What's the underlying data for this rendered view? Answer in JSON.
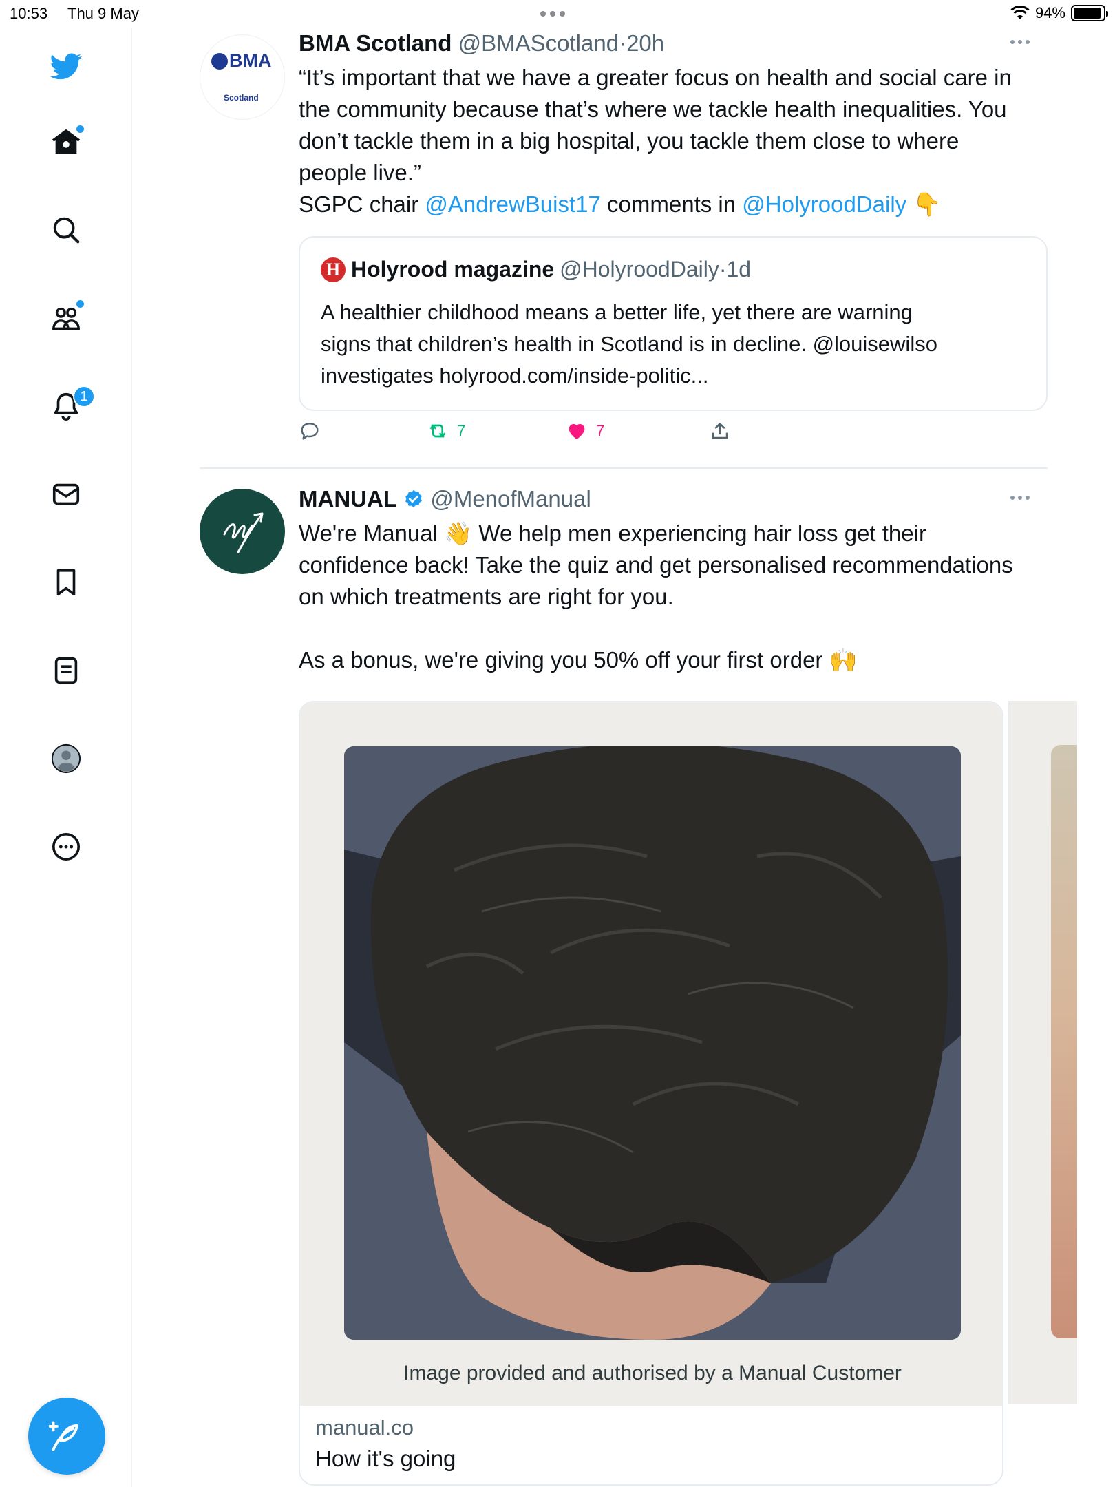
{
  "status_bar": {
    "time": "10:53",
    "date": "Thu 9 May",
    "battery": "94%",
    "battery_level": 0.94
  },
  "sidebar": {
    "items": [
      {
        "icon": "twitter-bird-icon"
      },
      {
        "icon": "home-icon",
        "has_dot": true
      },
      {
        "icon": "search-icon"
      },
      {
        "icon": "communities-icon",
        "has_dot": true
      },
      {
        "icon": "notifications-bell-icon",
        "badge": "1"
      },
      {
        "icon": "messages-envelope-icon"
      },
      {
        "icon": "bookmark-icon"
      },
      {
        "icon": "lists-icon"
      },
      {
        "icon": "profile-avatar-icon"
      },
      {
        "icon": "more-circle-icon"
      }
    ],
    "compose_icon": "compose-feather-icon",
    "accent_color": "#1d9bf0"
  },
  "tweets": [
    {
      "avatar": {
        "logo_text": "BMA",
        "logo_sub": "Scotland"
      },
      "name": "BMA Scotland",
      "handle": "@BMAScotland",
      "separator": "·",
      "time": "20h",
      "body": {
        "line1": "“It’s important that we have a greater focus on health and social care in",
        "line2": "the community because that’s where we tackle health inequalities. You",
        "line3": "don’t tackle them in a big hospital, you tackle them close to where",
        "line4": "people live.”",
        "line5_prefix": "SGPC chair ",
        "line5_mention1": "@AndrewBuist17",
        "line5_middle": " comments in ",
        "line5_mention2": "@HolyroodDaily",
        "line5_emoji": "👇"
      },
      "quote": {
        "logo_letter": "H",
        "name": "Holyrood magazine",
        "handle": "@HolyroodDaily",
        "separator": "·",
        "time": "1d",
        "line1": "A healthier childhood means a better life, yet there are warning",
        "line2": "signs that children’s health in Scotland is in decline. @louisewilso",
        "line3": "investigates holyrood.com/inside-politic..."
      },
      "actions": {
        "reply_count": "",
        "retweet_count": "7",
        "like_count": "7",
        "retweet_color": "#00ba7c",
        "like_color": "#f91880"
      }
    },
    {
      "name": "MANUAL",
      "verified": true,
      "handle": "@MenofManual",
      "body": {
        "line1_prefix": "We're Manual ",
        "line1_emoji": "👋",
        "line1_suffix": " We help men experiencing hair loss get their",
        "line2": "confidence back! Take the quiz and get personalised recommendations",
        "line3": "on which treatments are right for you.",
        "line4_prefix": "As a bonus, we're giving you 50% off your first order ",
        "line4_emoji": "🙌"
      },
      "card": {
        "caption": "Image provided and authorised by a Manual Customer",
        "domain": "manual.co",
        "title": "How it's going"
      }
    }
  ]
}
